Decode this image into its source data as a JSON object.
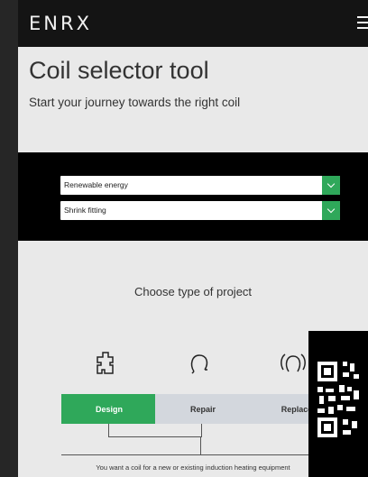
{
  "header": {
    "logo": "ENRX",
    "menu_icon": "hamburger-menu-icon"
  },
  "hero": {
    "title": "Coil selector tool",
    "subtitle": "Start your journey towards the right coil"
  },
  "filters": {
    "industry": {
      "selected": "Renewable energy",
      "icon": "chevron-down-icon"
    },
    "application": {
      "selected": "Shrink fitting",
      "icon": "chevron-down-icon"
    }
  },
  "project": {
    "heading": "Choose type of project",
    "options": [
      {
        "label": "Design",
        "icon": "puzzle-piece-icon",
        "state": "active"
      },
      {
        "label": "Repair",
        "icon": "coil-icon",
        "state": "inactive"
      },
      {
        "label": "Replace",
        "icon": "coil-replace-icon",
        "state": "inactive"
      }
    ],
    "description": "You want a coil for a new or existing induction heating equipment"
  },
  "colors": {
    "accent": "#2fa85a",
    "header": "#141414",
    "background": "#e9e9e9",
    "inactive_card": "#d3d7dd"
  }
}
